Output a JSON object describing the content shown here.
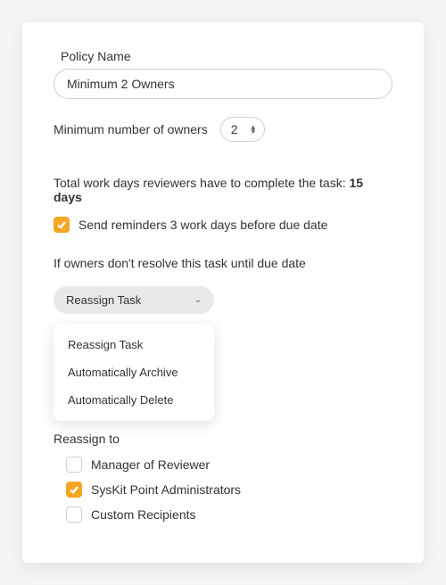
{
  "policy": {
    "label": "Policy Name",
    "value": "Minimum 2 Owners"
  },
  "min_owners": {
    "label": "Minimum number of owners",
    "value": "2"
  },
  "workdays": {
    "prefix": "Total work days reviewers have to complete the task: ",
    "value": "15 days"
  },
  "reminder": {
    "label": "Send reminders 3 work days before due date"
  },
  "unresolved": {
    "label": "If owners don't resolve this task until due date"
  },
  "action_dropdown": {
    "selected": "Reassign Task",
    "options": [
      "Reassign Task",
      "Automatically Archive",
      "Automatically Delete"
    ]
  },
  "reassign": {
    "label": "Reassign to",
    "options": {
      "manager": "Manager of Reviewer",
      "admins": "SysKit Point Administrators",
      "custom": "Custom Recipients"
    }
  }
}
